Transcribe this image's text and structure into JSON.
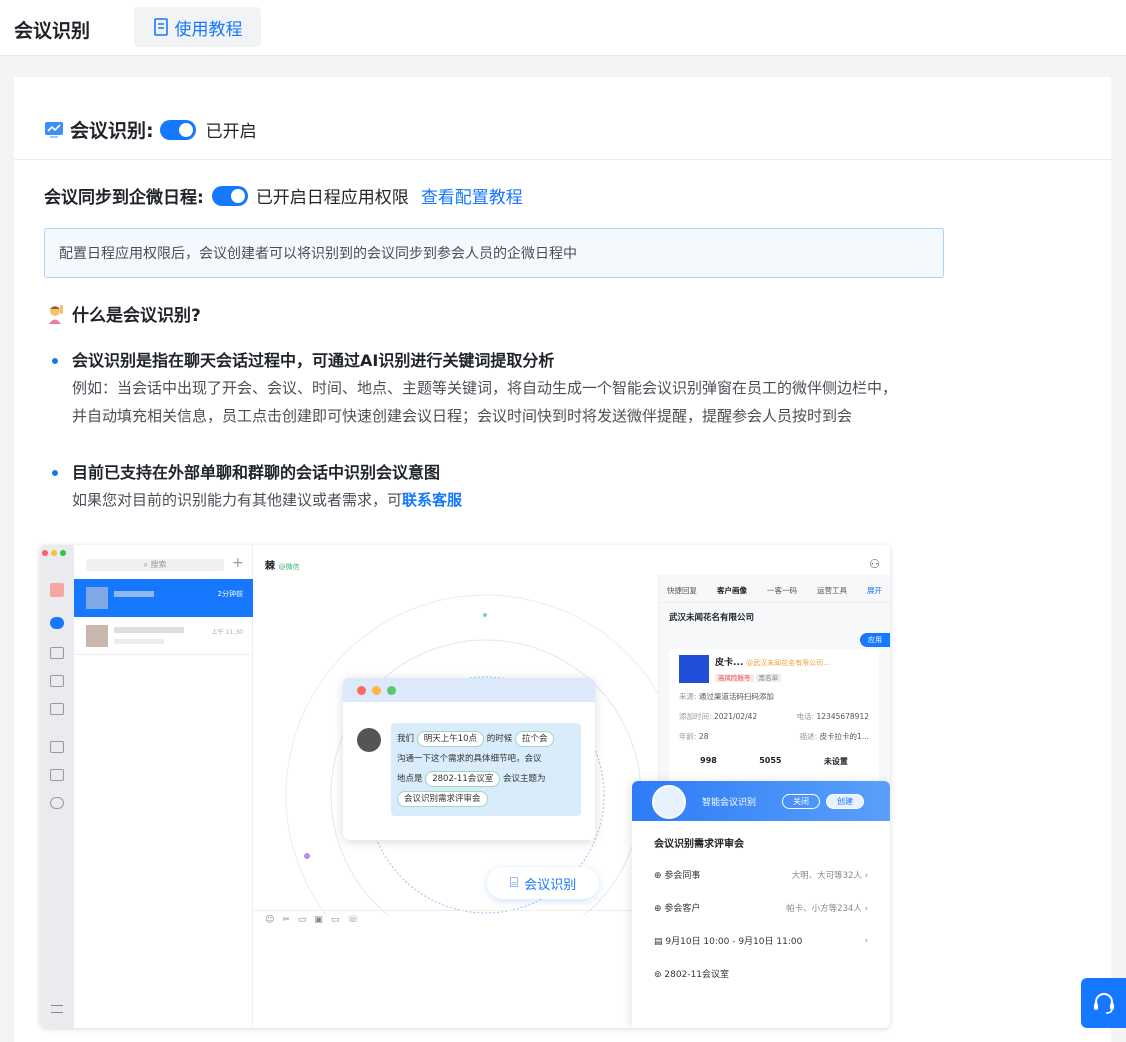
{
  "header": {
    "title": "会议识别",
    "tutorial_label": "使用教程"
  },
  "feature": {
    "label": "会议识别:",
    "status": "已开启",
    "enabled": true
  },
  "sync": {
    "label": "会议同步到企微日程:",
    "status": "已开启日程应用权限",
    "link": "查看配置教程",
    "enabled": true
  },
  "notice": "配置日程应用权限后，会议创建者可以将识别到的会议同步到参会人员的企微日程中",
  "what": {
    "title": "什么是会议识别?"
  },
  "bullets": [
    {
      "title": "会议识别是指在聊天会话过程中，可通过AI识别进行关键词提取分析",
      "lines": [
        "例如：当会话中出现了开会、会议、时间、地点、主题等关键词，将自动生成一个智能会议识别弹窗在员工的微伴侧边栏中，",
        "并自动填充相关信息，员工点击创建即可快速创建会议日程；会议时间快到时将发送微伴提醒，提醒参会人员按时到会"
      ]
    },
    {
      "title": "目前已支持在外部单聊和群聊的会话中识别会议意图",
      "line_prefix": "如果您对目前的识别能力有其他建议或者需求，可",
      "link": "联系客服"
    }
  ],
  "illustration": {
    "search_placeholder": "搜索",
    "chat_item_time": "2分钟前",
    "chat_item2_time": "上午 11:30",
    "chat_name": "棘",
    "chat_name_tag": "@微信",
    "tabs": [
      "快捷回复",
      "客户画像",
      "一客一码",
      "运营工具",
      "展开"
    ],
    "company": "武汉未闻花名有限公司",
    "app_label": "应用",
    "customer": {
      "name": "皮卡...",
      "org": "@武汉未闻花名有限公司...",
      "tag1": "高风险账号",
      "tag2": "黑名单",
      "source_label": "来源:",
      "source": "通过渠道活码扫码添加",
      "add_time_label": "添加时间:",
      "add_time": "2021/02/42",
      "phone_label": "电话:",
      "phone": "12345678912",
      "age_label": "年龄:",
      "age": "28",
      "desc_label": "描述:",
      "desc": "皮卡拉卡的1...",
      "stats": [
        "998",
        "5055",
        "未设置"
      ]
    },
    "bubble": {
      "p1": "我们",
      "c1": "明天上午10点",
      "p2": "的时候",
      "c2": "拉个会",
      "p3": "沟通一下这个需求的具体细节吧，会议",
      "p4": "地点是",
      "c3": "2802-11会议室",
      "p5": "会议主题为",
      "c4": "会议识别需求评审会"
    },
    "ai_badge": "会议识别",
    "meeting": {
      "header": "智能会议识别",
      "close": "关闭",
      "create": "创建",
      "title": "会议识别需求评审会",
      "rows": [
        {
          "label": "参会同事",
          "value": "大明、大可等32人"
        },
        {
          "label": "参会客户",
          "value": "帕卡、小方等234人"
        },
        {
          "label": "9月10日 10:00 - 9月10日 11:00",
          "value": ""
        },
        {
          "label": "2802-11会议室",
          "value": ""
        }
      ]
    }
  },
  "colors": {
    "accent": "#1677ff",
    "notice_bg": "#f4f9fe",
    "notice_border": "#a9d4f7"
  }
}
